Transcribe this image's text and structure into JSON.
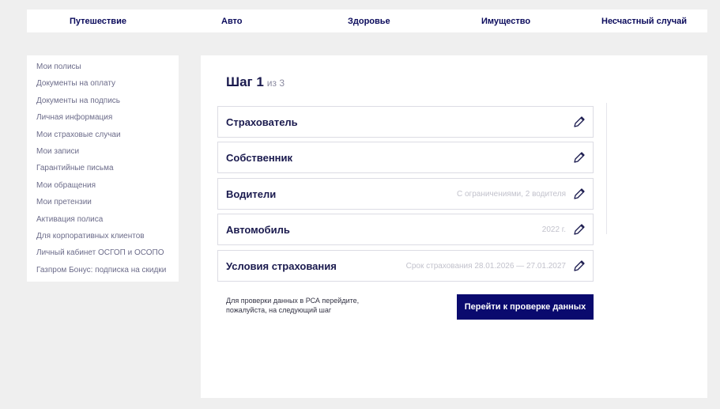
{
  "topnav": {
    "items": [
      "Путешествие",
      "Авто",
      "Здоровье",
      "Имущество",
      "Несчастный случай"
    ]
  },
  "sidebar": {
    "items": [
      "Мои полисы",
      "Документы на оплату",
      "Документы на подпись",
      "Личная информация",
      "Мои страховые случаи",
      "Мои записи",
      "Гарантийные письма",
      "Мои обращения",
      "Мои претензии",
      "Активация полиса",
      "Для корпоративных клиентов",
      "Личный кабинет ОСГОП и ОСОПО",
      "Газпром Бонус: подписка на скидки"
    ]
  },
  "step": {
    "title": "Шаг 1",
    "of": "из 3"
  },
  "cards": [
    {
      "title": "Страхователь",
      "hint": ""
    },
    {
      "title": "Собственник",
      "hint": ""
    },
    {
      "title": "Водители",
      "hint": "С ограничениями, 2 водителя"
    },
    {
      "title": "Автомобиль",
      "hint": "2022 г."
    },
    {
      "title": "Условия страхования",
      "hint": "Срок страхования 28.01.2026 — 27.01.2027"
    }
  ],
  "note": "Для проверки данных в РСА перейдите, пожалуйста, на следующий шаг",
  "cta_label": "Перейти к проверке данных",
  "icons": {
    "edit": "pencil-icon"
  },
  "colors": {
    "accent": "#0a0a6e",
    "background": "#efefef"
  }
}
